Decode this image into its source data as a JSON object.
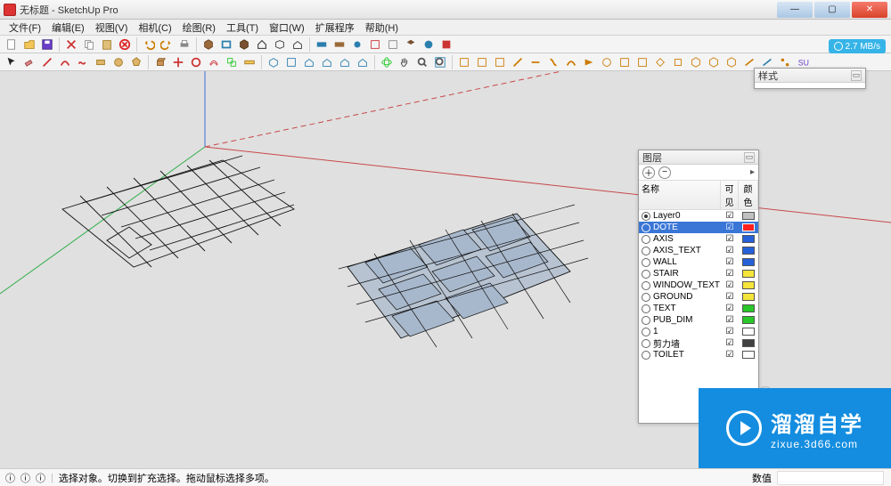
{
  "window": {
    "title": "无标题 - SketchUp Pro"
  },
  "menu": [
    "文件(F)",
    "编辑(E)",
    "视图(V)",
    "相机(C)",
    "绘图(R)",
    "工具(T)",
    "窗口(W)",
    "扩展程序",
    "帮助(H)"
  ],
  "speed_badge": "2.7 MB/s",
  "status": {
    "icons": 3,
    "hint": "选择对象。切换到扩充选择。拖动鼠标选择多项。",
    "dim_label": "数值"
  },
  "style_panel": {
    "title": "样式",
    "value": ""
  },
  "layers_panel": {
    "title": "图层",
    "columns": [
      "名称",
      "可见",
      "颜色"
    ],
    "rows": [
      {
        "name": "Layer0",
        "active": true,
        "visible": true,
        "color": "#c0c0c0",
        "selected": false
      },
      {
        "name": "DOTE",
        "active": false,
        "visible": true,
        "color": "#ff2020",
        "selected": true
      },
      {
        "name": "AXIS",
        "active": false,
        "visible": true,
        "color": "#2560d8",
        "selected": false
      },
      {
        "name": "AXIS_TEXT",
        "active": false,
        "visible": true,
        "color": "#2560d8",
        "selected": false
      },
      {
        "name": "WALL",
        "active": false,
        "visible": true,
        "color": "#2560d8",
        "selected": false
      },
      {
        "name": "STAIR",
        "active": false,
        "visible": true,
        "color": "#f5e53a",
        "selected": false
      },
      {
        "name": "WINDOW_TEXT",
        "active": false,
        "visible": true,
        "color": "#f5e53a",
        "selected": false
      },
      {
        "name": "GROUND",
        "active": false,
        "visible": true,
        "color": "#f5e53a",
        "selected": false
      },
      {
        "name": "TEXT",
        "active": false,
        "visible": true,
        "color": "#28c828",
        "selected": false
      },
      {
        "name": "PUB_DIM",
        "active": false,
        "visible": true,
        "color": "#28c828",
        "selected": false
      },
      {
        "name": "1",
        "active": false,
        "visible": true,
        "color": "#ffffff",
        "selected": false
      },
      {
        "name": "剪力墙",
        "active": false,
        "visible": true,
        "color": "#404040",
        "selected": false
      },
      {
        "name": "TOILET",
        "active": false,
        "visible": true,
        "color": "#ffffff",
        "selected": false
      }
    ]
  },
  "watermark": {
    "big": "溜溜自学",
    "url": "zixue.3d66.com"
  }
}
